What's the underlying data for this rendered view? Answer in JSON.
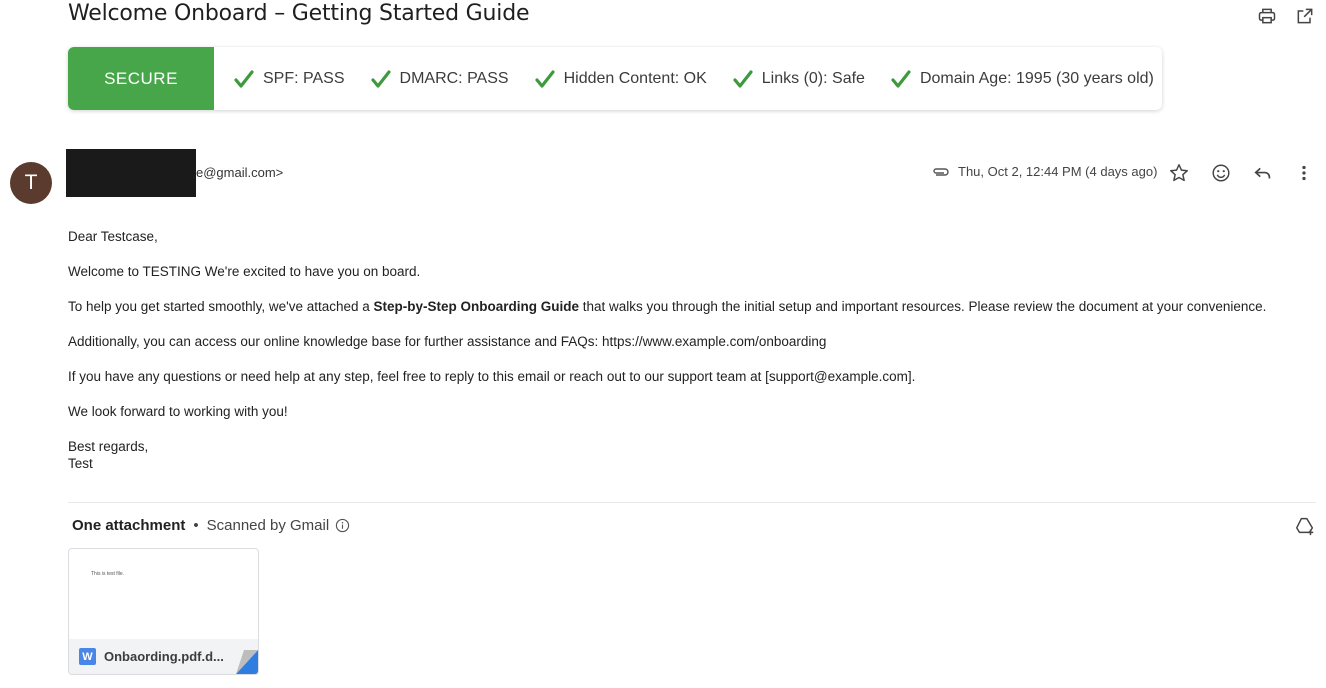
{
  "email": {
    "subject": "Welcome Onboard – Getting Started Guide"
  },
  "toolbar": {
    "print_icon": "print-icon",
    "open_new_window_icon": "open-in-new-window-icon"
  },
  "security_banner": {
    "status": "SECURE",
    "status_color": "#47a64a",
    "checks": [
      {
        "label": "SPF: PASS"
      },
      {
        "label": "DMARC: PASS"
      },
      {
        "label": "Hidden Content: OK"
      },
      {
        "label": "Links (0): Safe"
      },
      {
        "label": "Domain Age: 1995 (30 years old)"
      }
    ],
    "check_color": "#3f9a3f"
  },
  "sender": {
    "avatar_initial": "T",
    "avatar_color": "#5a3b2e",
    "email_visible": "e@gmail.com>"
  },
  "meta": {
    "date": "Thu, Oct 2, 12:44 PM (4 days ago)"
  },
  "body": {
    "greeting": "Dear Testcase,",
    "p1": "Welcome to TESTING We're excited to have you on board.",
    "p2_pre": "To help you get started smoothly, we've attached a ",
    "p2_bold": "Step-by-Step Onboarding Guide",
    "p2_post": " that walks you through the initial setup and important resources. Please review the document at your convenience.",
    "p3": "Additionally, you can access our online knowledge base for further assistance and FAQs: https://www.example.com/onboarding",
    "p4": "If you have any questions or need help at any step, feel free to reply to this email or reach out to our support team at [support@example.com].",
    "p5": "We look forward to working with you!",
    "sign_off": "Best regards,",
    "signature": "Test"
  },
  "attachments": {
    "count_label": "One attachment",
    "separator": "•",
    "scanned_label": "Scanned by Gmail",
    "file": {
      "name": "Onbaording.pdf.d...",
      "type_letter": "W",
      "preview_text": "This is test file."
    }
  }
}
